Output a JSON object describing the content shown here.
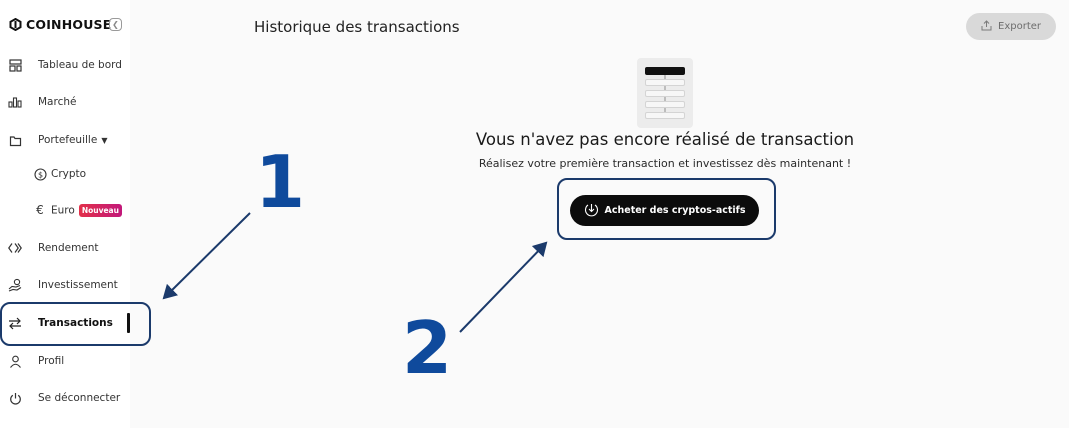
{
  "brand": {
    "name": "COINHOUSE"
  },
  "sidebar": {
    "items": [
      {
        "label": "Tableau de bord",
        "icon": "dashboard-icon"
      },
      {
        "label": "Marché",
        "icon": "bar-chart-icon"
      },
      {
        "label": "Portefeuille",
        "icon": "wallet-icon",
        "expanded": true
      },
      {
        "label": "Crypto",
        "icon": "dollar-circle-icon"
      },
      {
        "label": "Euro",
        "icon": "euro-icon",
        "badge": "Nouveau"
      },
      {
        "label": "Rendement",
        "icon": "yield-icon"
      },
      {
        "label": "Investissement",
        "icon": "hand-coin-icon"
      },
      {
        "label": "Transactions",
        "icon": "swap-arrows-icon",
        "active": true
      },
      {
        "label": "Profil",
        "icon": "user-icon"
      },
      {
        "label": "Se déconnecter",
        "icon": "power-icon"
      }
    ]
  },
  "header": {
    "title": "Historique des transactions",
    "export_label": "Exporter"
  },
  "empty_state": {
    "title": "Vous n'avez pas encore réalisé de transaction",
    "subtitle": "Réalisez votre première transaction et investissez dès maintenant !",
    "cta_label": "Acheter des cryptos-actifs"
  },
  "annotations": {
    "step1": "1",
    "step2": "2",
    "color": "#0f4a9c"
  },
  "colors": {
    "accent": "#0c0c0c",
    "badge": "#d6246a",
    "highlight_outline": "#1b3a6b"
  }
}
